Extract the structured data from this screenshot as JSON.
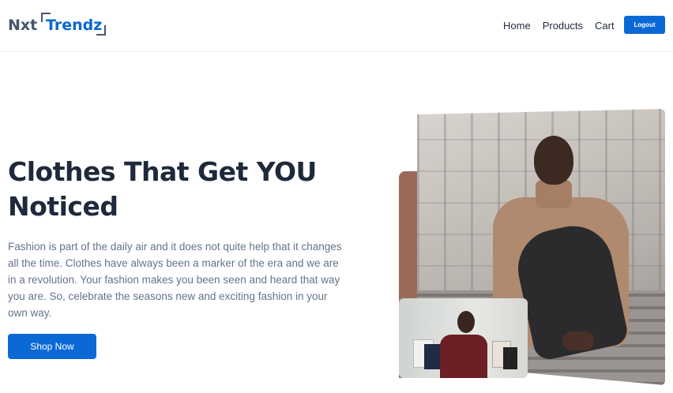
{
  "brand": {
    "part1": "Nxt",
    "part2": "Trendz"
  },
  "nav": {
    "home": "Home",
    "products": "Products",
    "cart": "Cart",
    "logout": "Logout"
  },
  "hero": {
    "heading": "Clothes That Get YOU Noticed",
    "description": "Fashion is part of the daily air and it does not quite help that it changes all the time. Clothes have always been a marker of the era and we are in a revolution. Your fashion makes you been seen and heard that way you are. So, celebrate the seasons new and exciting fashion in your own way.",
    "cta": "Shop Now"
  },
  "colors": {
    "primary": "#0b69d6",
    "heading": "#1e293b",
    "body_text": "#64748b",
    "accent_block": "#9b6b5a"
  }
}
